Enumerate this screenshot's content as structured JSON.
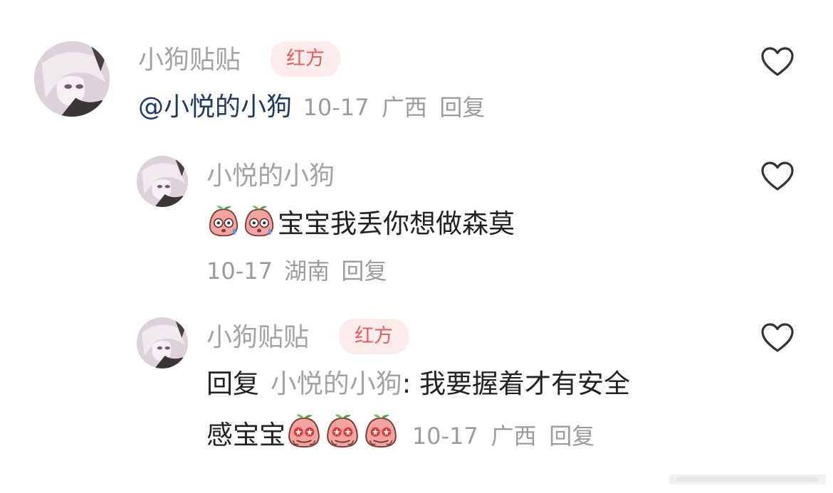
{
  "colors": {
    "badge_bg": "#fdecec",
    "badge_text": "#e65d5d",
    "meta": "#9c9c9c",
    "mention": "#1f3a63",
    "name": "#a3a3a3"
  },
  "comments": [
    {
      "username": "小狗贴贴",
      "badge": "红方",
      "mention": "@小悦的小狗",
      "date": "10-17",
      "location": "广西",
      "reply_label": "回复",
      "like_icon": "heart-outline-icon"
    },
    {
      "username": "小悦的小狗",
      "emojis": [
        "peach-sweat-emoji",
        "peach-sweat-emoji"
      ],
      "text": "宝宝我丢你想做森莫",
      "date": "10-17",
      "location": "湖南",
      "reply_label": "回复",
      "like_icon": "heart-outline-icon"
    },
    {
      "username": "小狗贴贴",
      "badge": "红方",
      "reply_prefix": "回复",
      "reply_target": "小悦的小狗",
      "text_part1": ": 我要握着才有安全",
      "text_part2": "感宝宝",
      "emojis": [
        "peach-starry-eyes-emoji",
        "peach-starry-eyes-emoji",
        "peach-starry-eyes-emoji"
      ],
      "date": "10-17",
      "location": "广西",
      "reply_label": "回复",
      "like_icon": "heart-outline-icon"
    }
  ]
}
